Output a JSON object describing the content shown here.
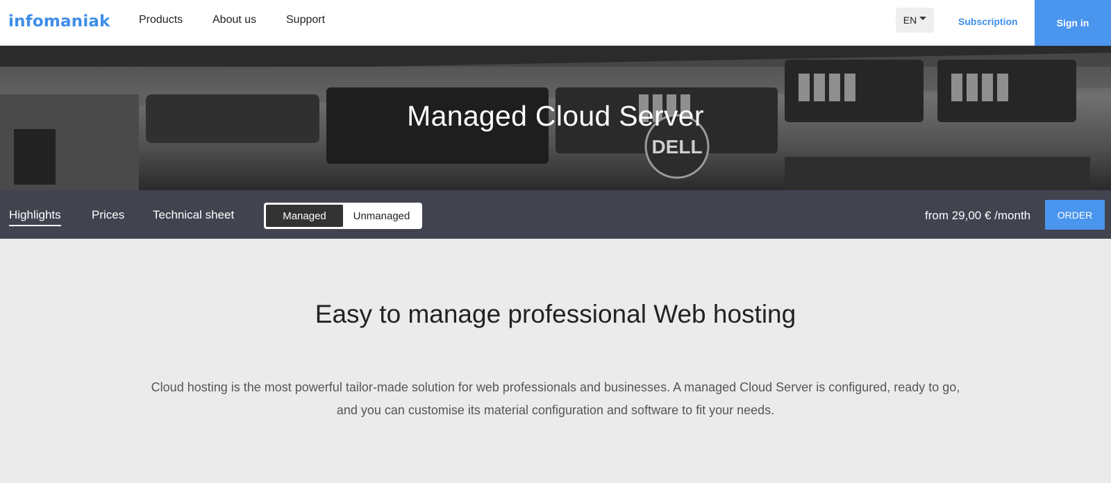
{
  "header": {
    "logo": "infomaniak",
    "nav": [
      "Products",
      "About us",
      "Support"
    ],
    "lang": "EN",
    "subscription": "Subscription",
    "signin": "Sign in"
  },
  "hero": {
    "title": "Managed Cloud Server",
    "image_brand": "DELL"
  },
  "subnav": {
    "tabs": [
      "Highlights",
      "Prices",
      "Technical sheet"
    ],
    "toggle": [
      "Managed",
      "Unmanaged"
    ],
    "price": "from 29,00 € /month",
    "order": "ORDER"
  },
  "main": {
    "title": "Easy to manage professional Web hosting",
    "description": "Cloud hosting is the most powerful tailor-made solution for web professionals and businesses. A managed Cloud Server is configured, ready to go, and you can customise its material configuration and software to fit your needs."
  },
  "colors": {
    "brand": "#3e8ee8",
    "accent_button": "#4a95ed",
    "subnav_bg": "#41434f",
    "page_bg": "#ebebeb"
  }
}
